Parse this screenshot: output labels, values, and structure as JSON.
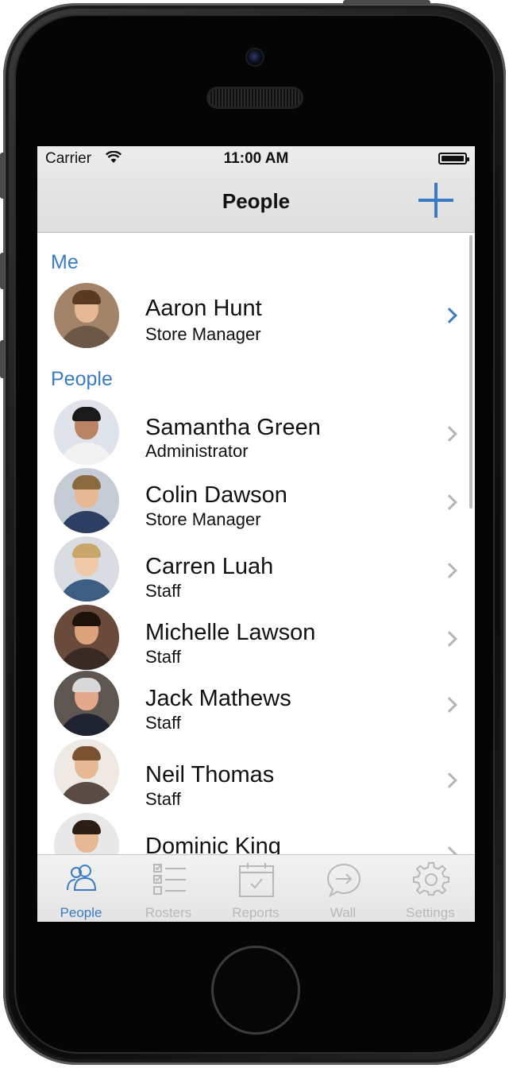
{
  "status_bar": {
    "carrier": "Carrier",
    "time": "11:00 AM"
  },
  "nav": {
    "title": "People"
  },
  "sections": {
    "me": "Me",
    "people": "People"
  },
  "me": {
    "name": "Aaron Hunt",
    "role": "Store Manager"
  },
  "people": [
    {
      "name": "Samantha Green",
      "role": "Administrator"
    },
    {
      "name": "Colin Dawson",
      "role": "Store Manager"
    },
    {
      "name": "Carren Luah",
      "role": "Staff"
    },
    {
      "name": "Michelle Lawson",
      "role": "Staff"
    },
    {
      "name": "Jack Mathews",
      "role": "Staff"
    },
    {
      "name": "Neil Thomas",
      "role": "Staff"
    },
    {
      "name": "Dominic King",
      "role": ""
    }
  ],
  "tabs": [
    {
      "label": "People",
      "icon": "people-icon",
      "active": true
    },
    {
      "label": "Rosters",
      "icon": "rosters-icon",
      "active": false
    },
    {
      "label": "Reports",
      "icon": "reports-icon",
      "active": false
    },
    {
      "label": "Wall",
      "icon": "wall-icon",
      "active": false
    },
    {
      "label": "Settings",
      "icon": "settings-icon",
      "active": false
    }
  ],
  "colors": {
    "accent": "#3a7cc4",
    "inactive": "#b8b8b8"
  }
}
